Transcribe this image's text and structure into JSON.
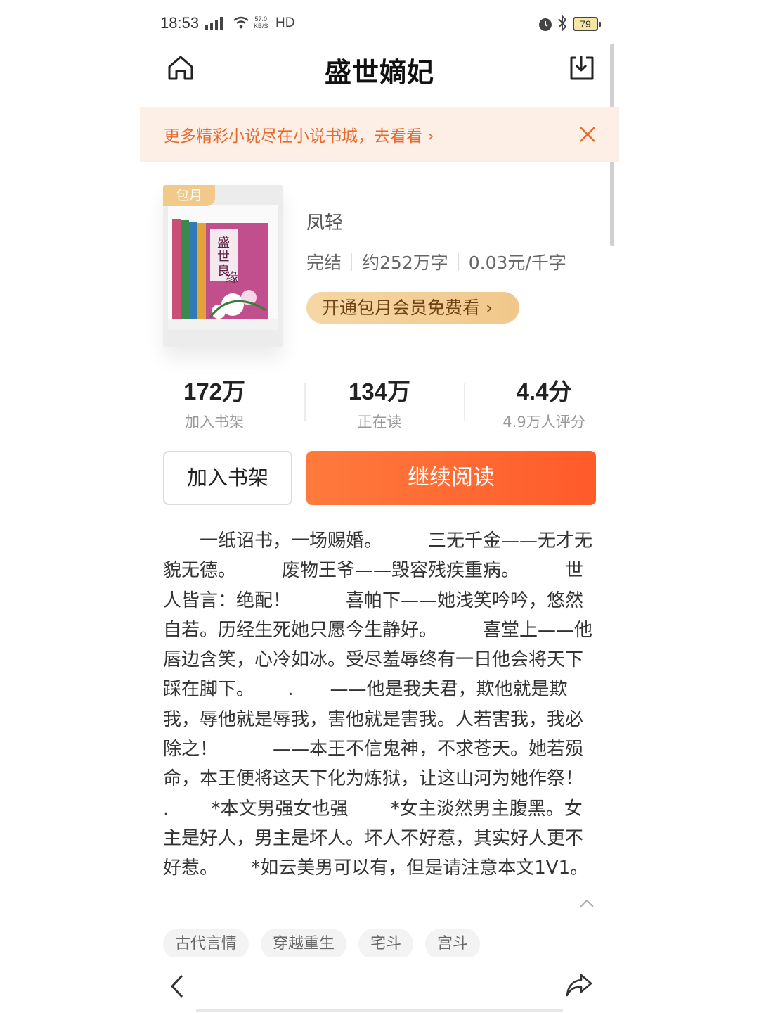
{
  "status_bar": {
    "time": "18:53",
    "network": "4G",
    "speed_value": "57.0",
    "speed_unit": "KB/S",
    "hd": "HD",
    "battery": "79"
  },
  "header": {
    "title": "盛世嫡妃",
    "home_icon": "home-icon",
    "download_icon": "download-icon"
  },
  "banner": {
    "text": "更多精彩小说尽在小说书城，去看看 ›"
  },
  "book": {
    "badge": "包月",
    "author": "凤轻",
    "status": "完结",
    "word_count": "约252万字",
    "price": "0.03元/千字",
    "vip_button": "开通包月会员免费看 ›"
  },
  "stats": [
    {
      "value": "172万",
      "label": "加入书架"
    },
    {
      "value": "134万",
      "label": "正在读"
    },
    {
      "value": "4.4分",
      "label": "4.9万人评分"
    }
  ],
  "actions": {
    "add_to_shelf": "加入书架",
    "continue_reading": "继续阅读"
  },
  "synopsis": "　　一纸诏书，一场赐婚。　　　三无千金——无才无貌无德。　　　废物王爷——毁容残疾重病。　　　世人皆言：绝配！　　　喜帕下——她浅笑吟吟，悠然自若。历经生死她只愿今生静好。　　　喜堂上——他唇边含笑，心冷如冰。受尽羞辱终有一日他会将天下踩在脚下。　　 .　　——他是我夫君，欺他就是欺我，辱他就是辱我，害他就是害我。人若害我，我必除之！　　　——本王不信鬼神，不求苍天。她若殒命，本王便将这天下化为炼狱，让这山河为她作祭！　　 .　　 *本文男强女也强　　 *女主淡然男主腹黑。女主是好人，男主是坏人。坏人不好惹，其实好人更不好惹。　　 *如云美男可以有，但是请注意本文1V1。",
  "tags": [
    "古代言情",
    "穿越重生",
    "宅斗",
    "宫斗"
  ],
  "colors": {
    "accent": "#ff6a33",
    "banner_bg": "#fdeee6",
    "banner_text": "#e86a2c",
    "vip_gold": "#f1c78b"
  }
}
